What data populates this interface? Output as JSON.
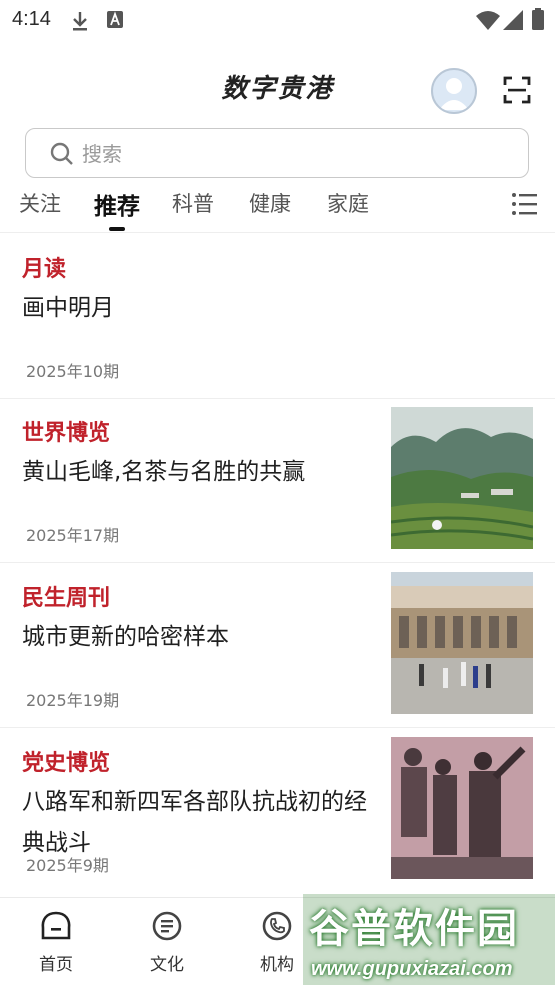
{
  "status_bar": {
    "time": "4:14"
  },
  "header": {
    "title": "数字贵港"
  },
  "search": {
    "placeholder": "搜索"
  },
  "tabs": [
    {
      "label": "关注"
    },
    {
      "label": "推荐",
      "active": true
    },
    {
      "label": "科普"
    },
    {
      "label": "健康"
    },
    {
      "label": "家庭"
    }
  ],
  "articles": [
    {
      "source": "月读",
      "title": "画中明月",
      "issue": "2025年10期",
      "has_image": false
    },
    {
      "source": "世界博览",
      "title": "黄山毛峰,名茶与名胜的共赢",
      "issue": "2025年17期",
      "has_image": true,
      "image_icon": "tea-mountain-photo"
    },
    {
      "source": "民生周刊",
      "title": "城市更新的哈密样本",
      "issue": "2025年19期",
      "has_image": true,
      "image_icon": "hami-station-photo"
    },
    {
      "source": "党史博览",
      "title": "八路军和新四军各部队抗战初的经典战斗",
      "issue": "2025年9期",
      "has_image": true,
      "image_icon": "soldiers-photo"
    }
  ],
  "bottom_nav": [
    {
      "label": "首页",
      "icon": "home-icon"
    },
    {
      "label": "文化",
      "icon": "culture-icon"
    },
    {
      "label": "机构",
      "icon": "phone-icon"
    }
  ],
  "watermark": {
    "title": "谷普软件园",
    "url": "www.gupuxiazai.com"
  },
  "colors": {
    "accent_red": "#c0222b",
    "text_primary": "#1f1f1f",
    "text_secondary": "#777777"
  }
}
